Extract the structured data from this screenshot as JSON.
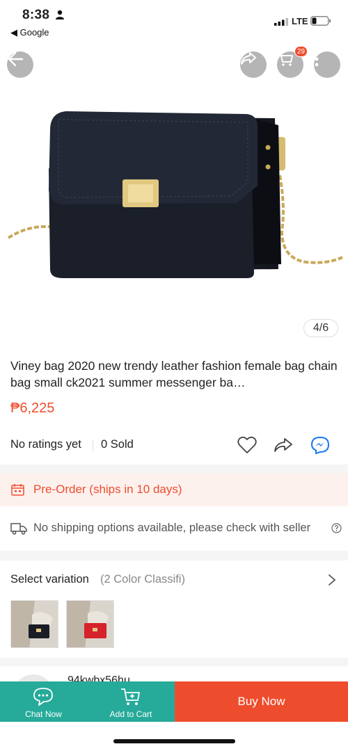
{
  "status_bar": {
    "time": "8:38",
    "back_app": "◀ Google",
    "network": "LTE"
  },
  "header": {
    "cart_count": "29",
    "icons": [
      "back-arrow-icon",
      "share-icon",
      "cart-icon",
      "more-icon"
    ]
  },
  "gallery": {
    "page_indicator": "4/6"
  },
  "product": {
    "title": "Viney bag 2020 new trendy leather fashion female bag chain bag small ck2021 summer messenger ba…",
    "price": "₱6,225",
    "rating": "No ratings yet",
    "sold": "0 Sold"
  },
  "preorder": {
    "text": "Pre-Order (ships in 10 days)"
  },
  "shipping": {
    "text": "No shipping options available, please check with seller"
  },
  "variation": {
    "label": "Select variation",
    "count": "(2 Color Classifi)",
    "options": [
      "black",
      "red"
    ]
  },
  "seller": {
    "name": "94kwbx56hu"
  },
  "bottom_bar": {
    "chat_label": "Chat Now",
    "cart_label": "Add to Cart",
    "buy_label": "Buy Now"
  },
  "colors": {
    "brand": "#ee4d2d",
    "teal": "#26aa99",
    "preorder_bg": "#fdf1ee"
  }
}
